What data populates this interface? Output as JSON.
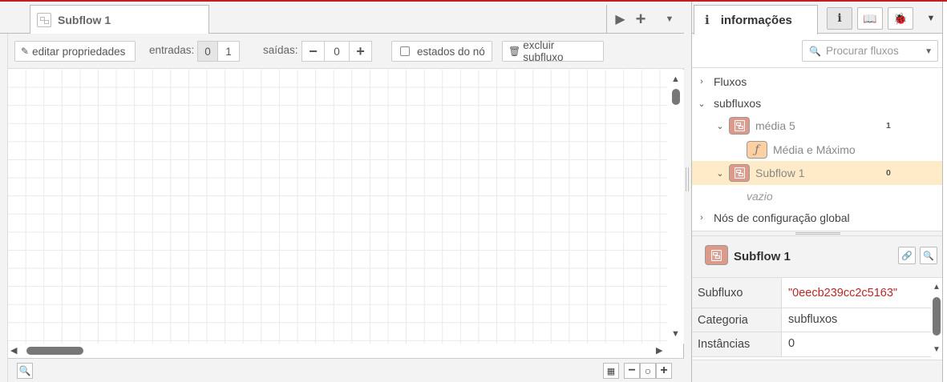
{
  "workspace": {
    "tab": {
      "label": "Subflow 1",
      "icon": "subflow-icon"
    },
    "tab_buttons": {
      "scroll": "▶",
      "add": "+",
      "menu": "▼"
    },
    "subflow_bar": {
      "edit_props": "editar propriedades",
      "inputs_label": "entradas:",
      "inputs_options": [
        "0",
        "1"
      ],
      "outputs_label": "saídas:",
      "outputs_value": "0",
      "minus": "−",
      "plus": "+",
      "node_status": "estados do nó",
      "delete_subflow": "excluir subfluxo"
    },
    "footer": {
      "zoom_out": "−",
      "zoom_reset": "○",
      "zoom_in": "+"
    }
  },
  "sidebar": {
    "tab_label": "informações",
    "tab_icon_glyph": "i",
    "search_placeholder": "Procurar fluxos",
    "tree": {
      "flows": "Fluxos",
      "subflows": "subfluxos",
      "media5": {
        "label": "média 5",
        "count": "1"
      },
      "media_max": "Média e Máximo",
      "subflow1": {
        "label": "Subflow 1",
        "count": "0"
      },
      "empty": "vazio",
      "global_config": "Nós de configuração global"
    },
    "info": {
      "title": "Subflow 1",
      "properties": [
        {
          "key": "Subfluxo",
          "value": "\"0eecb239cc2c5163\""
        },
        {
          "key": "Categoria",
          "value": "subfluxos"
        },
        {
          "key": "Instâncias",
          "value": "0"
        }
      ]
    }
  },
  "colors": {
    "subflow": "#dd9a8b",
    "function": "#fdd0a2",
    "selected_row": "#ffebc7",
    "accent_line": "#c02020"
  }
}
